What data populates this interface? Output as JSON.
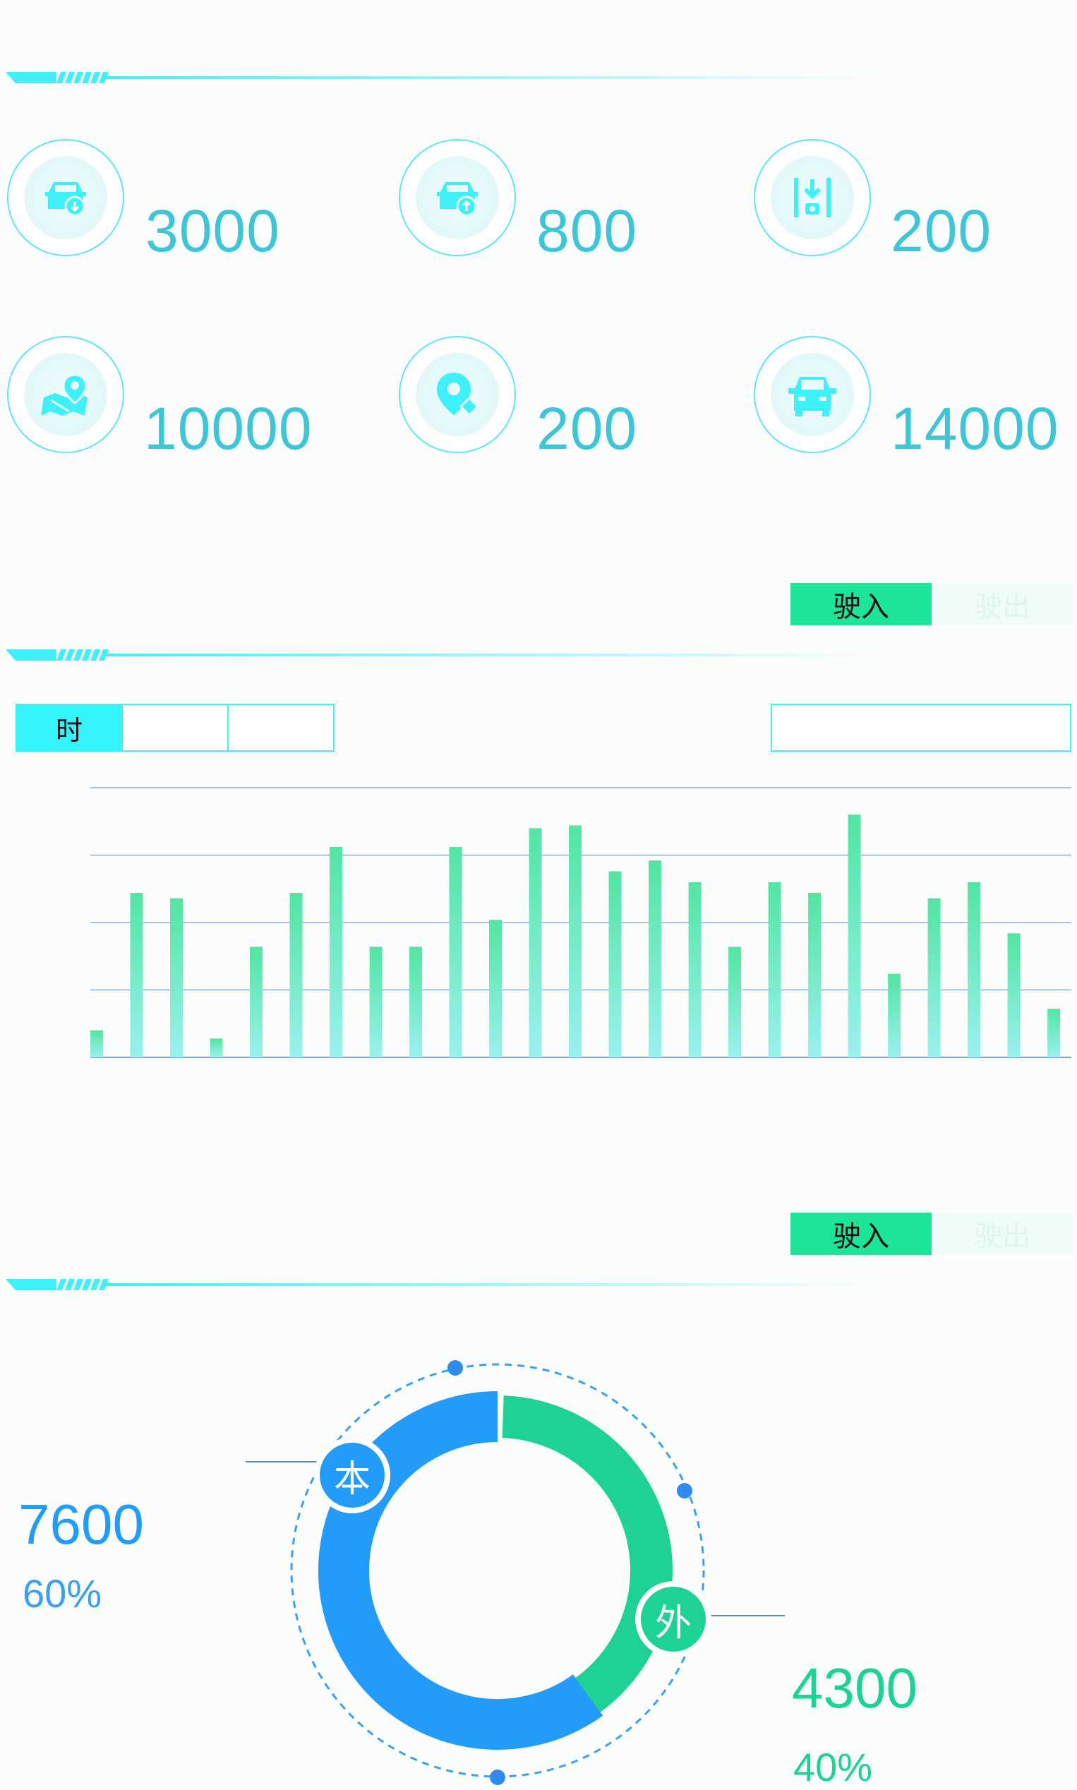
{
  "stats": [
    {
      "icon": "car-in-icon",
      "value": "3000"
    },
    {
      "icon": "car-out-icon",
      "value": "800"
    },
    {
      "icon": "parking-entry-icon",
      "value": "200"
    },
    {
      "icon": "map-location-icon",
      "value": "10000"
    },
    {
      "icon": "location-pin-icon",
      "value": "200"
    },
    {
      "icon": "car-front-icon",
      "value": "14000"
    }
  ],
  "toggle1": {
    "on": "驶入",
    "off": "驶出"
  },
  "toggle2": {
    "on": "驶入",
    "off": "驶出"
  },
  "period_tabs": [
    {
      "label": "时",
      "active": true
    },
    {
      "label": "",
      "active": false
    },
    {
      "label": "",
      "active": false
    }
  ],
  "chart_data": {
    "type": "bar",
    "values": [
      10,
      61,
      59,
      7,
      41,
      61,
      78,
      41,
      41,
      78,
      51,
      85,
      86,
      69,
      73,
      65,
      41,
      65,
      61,
      90,
      31,
      59,
      65,
      46,
      18
    ],
    "ylim": [
      0,
      100
    ],
    "grid": true
  },
  "donut": {
    "local": {
      "badge": "本",
      "value": "7600",
      "percent": "60%",
      "color": "#229bf9"
    },
    "outside": {
      "badge": "外",
      "value": "4300",
      "percent": "40%",
      "color": "#1ed293"
    }
  },
  "colors": {
    "accent": "#3ff0f8",
    "green": "#1de598",
    "number": "#3ec6d8"
  }
}
